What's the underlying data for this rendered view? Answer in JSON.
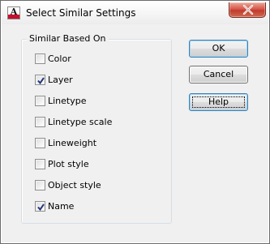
{
  "window": {
    "title": "Select Similar Settings",
    "app_icon": "autocad-app-icon",
    "close_icon": "close-icon"
  },
  "group": {
    "title": "Similar Based On",
    "items": [
      {
        "label": "Color",
        "checked": false
      },
      {
        "label": "Layer",
        "checked": true
      },
      {
        "label": "Linetype",
        "checked": false
      },
      {
        "label": "Linetype scale",
        "checked": false
      },
      {
        "label": "Lineweight",
        "checked": false
      },
      {
        "label": "Plot style",
        "checked": false
      },
      {
        "label": "Object style",
        "checked": false
      },
      {
        "label": "Name",
        "checked": true
      }
    ]
  },
  "buttons": {
    "ok": "OK",
    "cancel": "Cancel",
    "help": "Help"
  },
  "colors": {
    "close_button": "#c13b2b",
    "app_icon_bar": "#c8102e",
    "default_button_border": "#3c7fb1"
  }
}
